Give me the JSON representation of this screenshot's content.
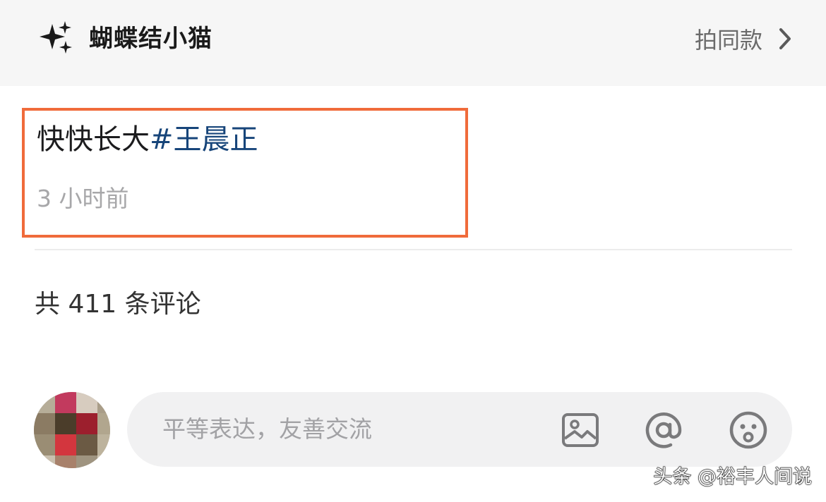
{
  "header": {
    "effect_name": "蝴蝶结小猫",
    "same_style_label": "拍同款"
  },
  "post": {
    "caption_text": "快快长大",
    "hashtag": "#王晨正",
    "time": "3 小时前"
  },
  "comments": {
    "count_label": "共 411 条评论"
  },
  "comment_box": {
    "placeholder": "平等表达，友善交流",
    "icons": [
      "image-icon",
      "mention-icon",
      "emoji-icon"
    ]
  },
  "watermark": "头条 @裕丰人间说",
  "colors": {
    "highlight_border": "#f06b3b",
    "hashtag": "#17457a",
    "muted_text": "#a7a7a9",
    "input_bg": "#f1f1f2"
  }
}
